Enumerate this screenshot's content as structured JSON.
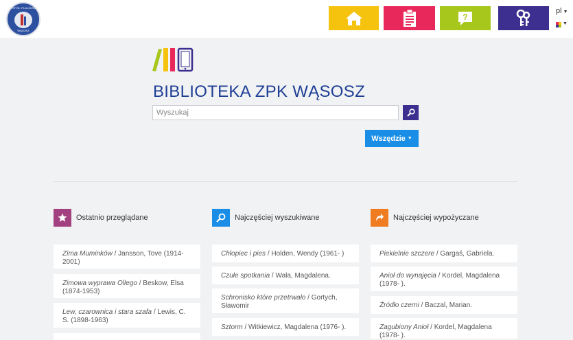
{
  "header": {
    "logo_text_top": "ZESPÓŁ PLACÓWEK",
    "logo_text_bottom": "WĄSOSZ",
    "nav": [
      {
        "name": "home",
        "color": "#f5c30e"
      },
      {
        "name": "clipboard",
        "color": "#e8285a"
      },
      {
        "name": "help",
        "color": "#a8c71c"
      },
      {
        "name": "keys",
        "color": "#3c2f8f"
      }
    ],
    "language": "pl"
  },
  "main": {
    "title": "BIBLIOTEKA ZPK WĄSOSZ",
    "search_placeholder": "Wyszukaj",
    "search_value": "",
    "scope_label": "Wszędzie"
  },
  "columns": [
    {
      "title": "Ostatnio przeglądane",
      "icon": "star-icon",
      "color": "#a3407f",
      "items": [
        {
          "title": "Zima Muminków",
          "author": "Jansson, Tove (1914-2001)"
        },
        {
          "title": "Zimowa wyprawa Ollego",
          "author": "Beskow, Elsa (1874-1953)"
        },
        {
          "title": "Lew, czarownica i stara szafa",
          "author": "Lewis, C. S. (1898-1963)"
        }
      ]
    },
    {
      "title": "Najczęściej wyszukiwane",
      "icon": "search-icon",
      "color": "#1a8ee6",
      "items": [
        {
          "title": "Chłopiec i pies",
          "author": "Holden, Wendy (1961- )"
        },
        {
          "title": "Czułe spotkania",
          "author": "Wala, Magdalena."
        },
        {
          "title": "Schronisko które przetrwało",
          "author": "Gortych, Sławomir"
        },
        {
          "title": "Sztorm",
          "author": "Witkiewicz, Magdalena (1976- )."
        }
      ]
    },
    {
      "title": "Najczęściej wypożyczane",
      "icon": "share-arrow-icon",
      "color": "#f07c22",
      "items": [
        {
          "title": "Piekielnie szczere",
          "author": "Gargaś, Gabriela."
        },
        {
          "title": "Anioł do wynajęcia",
          "author": "Kordel, Magdalena (1978- )."
        },
        {
          "title": "Źródło czerni",
          "author": "Baczal, Marian."
        },
        {
          "title": "Zagubiony Anioł",
          "author": "Kordel, Magdalena (1978- )."
        }
      ]
    }
  ]
}
